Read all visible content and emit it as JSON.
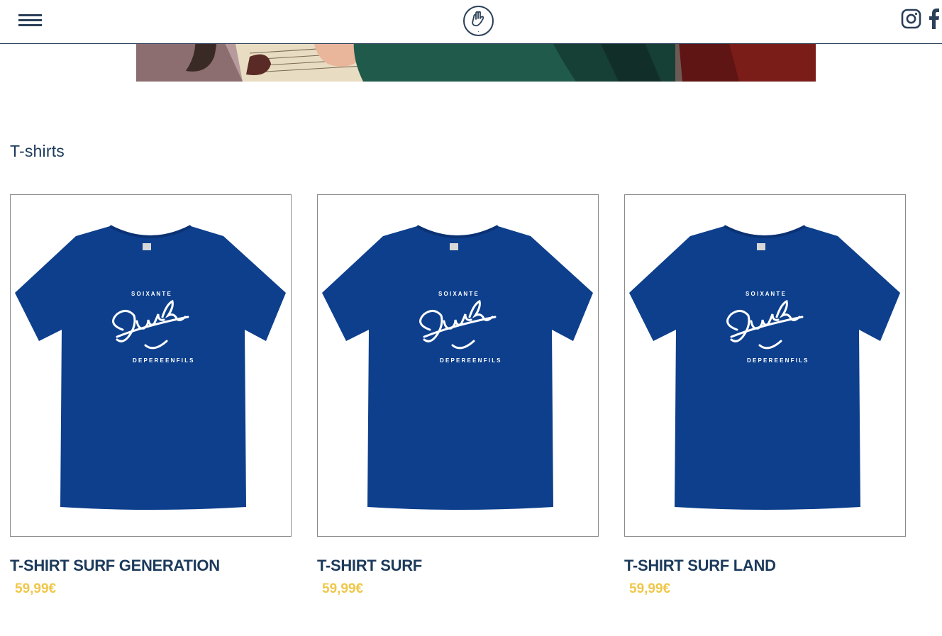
{
  "header": {
    "menu_icon": "hamburger-menu-icon",
    "logo_icon": "shaka-hand-logo-icon",
    "social": [
      {
        "name": "Instagram",
        "icon": "instagram-icon"
      },
      {
        "name": "Facebook",
        "icon": "facebook-icon"
      }
    ]
  },
  "section": {
    "title": "T-shirts"
  },
  "products": [
    {
      "name": "T-SHIRT SURF GENERATION",
      "price": "59,99",
      "currency": "€"
    },
    {
      "name": "T-SHIRT SURF",
      "price": "59,99",
      "currency": "€"
    },
    {
      "name": "T-SHIRT SURF LAND",
      "price": "59,99",
      "currency": "€"
    }
  ],
  "colors": {
    "navy": "#1c3a5b",
    "price_yellow": "#f0c74a",
    "shirt_blue": "#0d3f8c"
  }
}
